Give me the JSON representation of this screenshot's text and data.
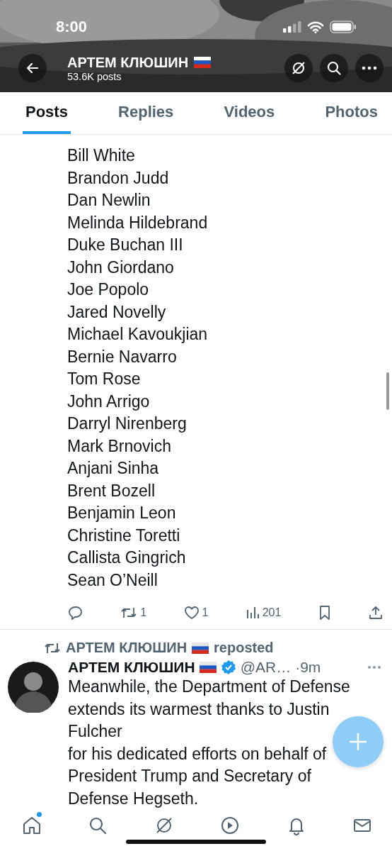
{
  "status_bar": {
    "time": "8:00"
  },
  "header": {
    "name": "АРТЕМ КЛЮШИН",
    "post_count": "53.6K posts"
  },
  "tabs": [
    {
      "label": "Posts",
      "selected": true
    },
    {
      "label": "Replies",
      "selected": false
    },
    {
      "label": "Videos",
      "selected": false
    },
    {
      "label": "Photos",
      "selected": false
    }
  ],
  "post": {
    "lines": [
      "Bill White",
      "Brandon Judd",
      "Dan Newlin",
      "Melinda Hildebrand",
      "Duke Buchan III",
      "John Giordano",
      "Joe Popolo",
      "Jared Novelly",
      "Michael Kavoukjian",
      "Bernie Navarro",
      "Tom Rose",
      "John Arrigo",
      "Darryl Nirenberg",
      "Mark Brnovich",
      "Anjani Sinha",
      "Brent Bozell",
      "Benjamin Leon",
      "Christine Toretti",
      "Callista Gingrich",
      "Sean O’Neill"
    ],
    "actions": [
      {
        "kind": "reply"
      },
      {
        "kind": "repost",
        "count": "1"
      },
      {
        "kind": "like",
        "count": "1"
      },
      {
        "kind": "views",
        "count": "201"
      },
      {
        "kind": "bookmark"
      },
      {
        "kind": "share"
      }
    ]
  },
  "next_post": {
    "reposted_by": "АРТЕМ КЛЮШИН",
    "repost_label": "reposted",
    "author": "АРТЕМ КЛЮШИН",
    "verified": true,
    "handle": "@AR…",
    "time": "·9m",
    "lines": [
      "Meanwhile, the Department of Defense",
      "extends its warmest thanks to Justin",
      "Fulcher",
      "for his dedicated efforts on behalf of",
      "President Trump and Secretary of",
      "Defense Hegseth."
    ]
  },
  "nav": [
    {
      "kind": "home",
      "badge": true
    },
    {
      "kind": "search",
      "badge": false
    },
    {
      "kind": "grok",
      "badge": false
    },
    {
      "kind": "video",
      "badge": false
    },
    {
      "kind": "notifications",
      "badge": false
    },
    {
      "kind": "messages",
      "badge": false
    }
  ]
}
